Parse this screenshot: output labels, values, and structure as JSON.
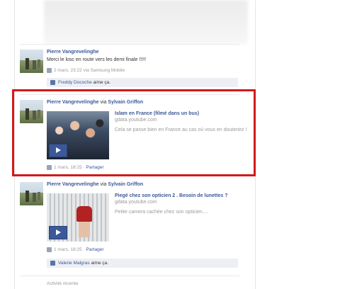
{
  "story1": {
    "actor": "Pierre Vangrevelinghe",
    "message": "Merci le losc en route vers les demi finale !!!!!",
    "meta": "2 mars, 23:22 via Samsung Mobile",
    "likes": {
      "name": "Freddy Docoche",
      "suffix": "aime ça."
    }
  },
  "story2": {
    "actor": "Pierre Vangrevelinghe",
    "via_word": "via",
    "via_name": "Sylvain Griffon",
    "share": {
      "title": "Islam en France (filmé dans un bus)",
      "domain": "gdata.youtube.com",
      "description": "Cela se passe bien en France au cas où vous en douteriez !"
    },
    "meta_time": "1 mars, 18:25",
    "meta_sep": "·",
    "share_label": "Partager"
  },
  "story3": {
    "actor": "Pierre Vangrevelinghe",
    "via_word": "via",
    "via_name": "Sylvain Griffon",
    "share": {
      "title": "Piegé chez son opticien 2 . Besoin de lunettes ?",
      "domain": "gdata.youtube.com",
      "description": "Petite camera cachée chez son opticien...."
    },
    "meta_time": "1 mars, 18:25",
    "meta_sep": "·",
    "share_label": "Partager",
    "likes": {
      "name": "Valerie Malgras",
      "suffix": "aime ça."
    }
  },
  "footer": {
    "label": "Activité récente"
  },
  "colors": {
    "link": "#3b5998",
    "highlight_border": "#d11a1a",
    "like_bg": "#edeff4"
  }
}
